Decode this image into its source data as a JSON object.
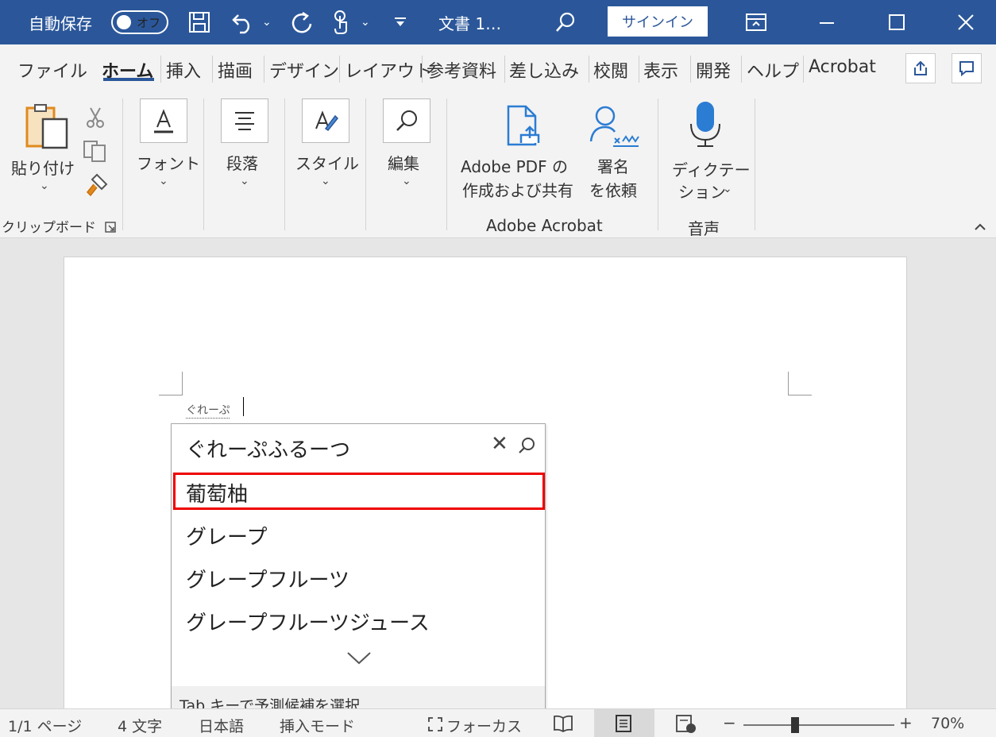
{
  "titlebar": {
    "autosave_label": "自動保存",
    "autosave_state": "オフ",
    "doc_title": "文書 1…",
    "signin_label": "サインイン",
    "icons": [
      "save-icon",
      "undo-icon",
      "redo-icon",
      "touch-mode-icon",
      "customize-qat-icon",
      "search-icon",
      "ribbon-display-icon",
      "minimize-icon",
      "maximize-icon",
      "close-icon"
    ]
  },
  "tabs": [
    "ファイル",
    "ホーム",
    "挿入",
    "描画",
    "デザイン",
    "レイアウト",
    "参考資料",
    "差し込み",
    "校閲",
    "表示",
    "開発",
    "ヘルプ",
    "Acrobat"
  ],
  "active_tab": "ホーム",
  "ribbon": {
    "paste_label": "貼り付け",
    "clipboard_group": "クリップボード",
    "font_label": "フォント",
    "paragraph_label": "段落",
    "styles_label": "スタイル",
    "editing_label": "編集",
    "adobe_pdf_line1": "Adobe PDF の",
    "adobe_pdf_line2": "作成および共有",
    "sign_line1": "署名",
    "sign_line2": "を依頼",
    "adobe_group": "Adobe Acrobat",
    "dictate_line1": "ディクテー",
    "dictate_line2": "ション",
    "voice_group": "音声"
  },
  "document": {
    "typed_text": "ぐれーぷ"
  },
  "ime": {
    "input": "ぐれーぷふるーつ",
    "candidates": [
      "葡萄柚",
      "グレープ",
      "グレープフルーツ",
      "グレープフルーツジュース"
    ],
    "selected_index": 0,
    "footer": "Tab キーで予測候補を選択"
  },
  "status": {
    "page": "1/1 ページ",
    "words": "4 文字",
    "language": "日本語",
    "mode": "挿入モード",
    "focus": "フォーカス",
    "zoom": "70%"
  },
  "colors": {
    "titlebar": "#2b579a",
    "selection_border": "#e00000"
  }
}
